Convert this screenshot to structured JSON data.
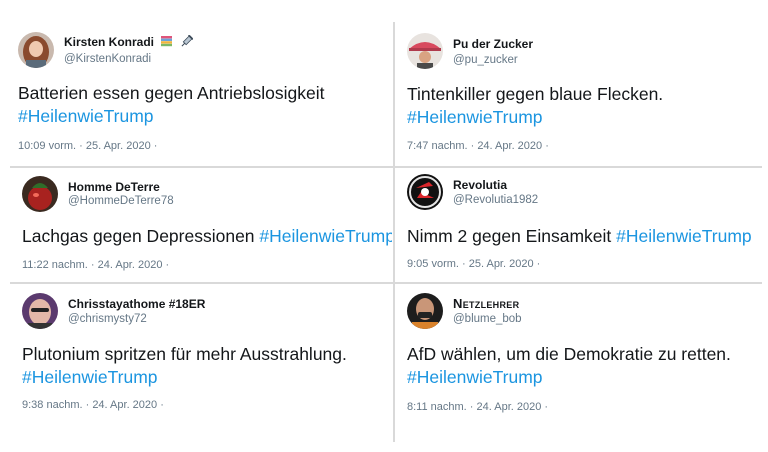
{
  "tweets": [
    {
      "name": "Kirsten Konradi",
      "handle": "@KirstenKonradi",
      "text": "Batterien essen gegen Antriebslosigkeit",
      "hashtag": "#HeilenwieTrump",
      "timestamp": "10:09 vorm. · 25. Apr. 2020 ·",
      "name_icons": [
        "books-emoji",
        "syringe-emoji"
      ]
    },
    {
      "name": "Pu der Zucker",
      "handle": "@pu_zucker",
      "text": "Tintenkiller gegen blaue Flecken.",
      "hashtag": "#HeilenwieTrump",
      "timestamp": "7:47 nachm. · 24. Apr. 2020 ·"
    },
    {
      "name": "Homme DeTerre",
      "handle": "@HommeDeTerre78",
      "text": "Lachgas gegen Depressionen",
      "hashtag": "#HeilenwieTrump",
      "timestamp": "11:22 nachm. · 24. Apr. 2020 ·"
    },
    {
      "name": "Revolutia",
      "handle": "@Revolutia1982",
      "text": "Nimm 2 gegen Einsamkeit",
      "hashtag": "#HeilenwieTrump",
      "timestamp": "9:05 vorm. · 25. Apr. 2020 ·"
    },
    {
      "name": "Chrisstayathome #18ER",
      "handle": "@chrismysty72",
      "text": "Plutonium spritzen für mehr Ausstrahlung.",
      "hashtag": "#HeilenwieTrump",
      "timestamp": "9:38 nachm. · 24. Apr. 2020 ·"
    },
    {
      "name": "Netzlehrer",
      "handle": "@blume_bob",
      "text": "AfD wählen, um die Demokratie zu retten.",
      "hashtag": "#HeilenwieTrump",
      "timestamp": "8:11 nachm. · 24. Apr. 2020 ·"
    }
  ],
  "colors": {
    "hashtag": "#1b95e0",
    "handle": "#657786",
    "text": "#14171a",
    "divider": "#d9d9d9"
  }
}
